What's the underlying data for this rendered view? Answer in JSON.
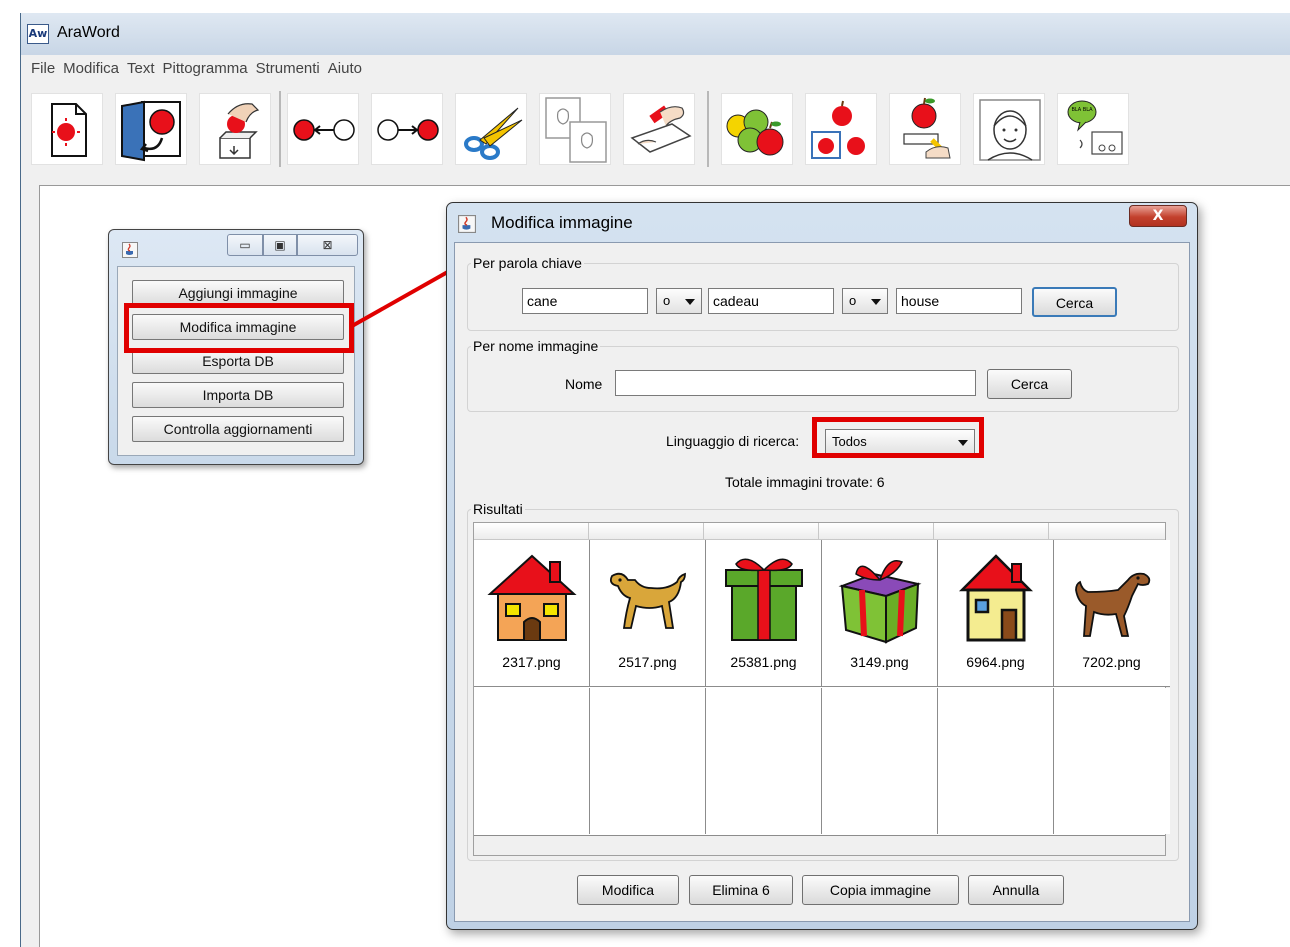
{
  "app": {
    "icon_text": "Aw",
    "title": "AraWord"
  },
  "menu": [
    "File",
    "Modifica",
    "Text",
    "Pittogramma",
    "Strumenti",
    "Aiuto"
  ],
  "db_dialog": {
    "buttons": [
      "Aggiungi immagine",
      "Modifica immagine",
      "Esporta DB",
      "Importa DB",
      "Controlla aggiornamenti"
    ]
  },
  "edit_dialog": {
    "title": "Modifica immagine",
    "close_label": "X",
    "keyword_section": {
      "label": "Per parola chiave",
      "field1": "cane",
      "op1": "o",
      "field2": "cadeau",
      "op2": "o",
      "field3": "house",
      "search_label": "Cerca"
    },
    "name_section": {
      "label": "Per nome immagine",
      "name_label": "Nome",
      "name_value": "",
      "search_label": "Cerca"
    },
    "language_label": "Linguaggio di ricerca:",
    "language_value": "Todos",
    "total_label": "Totale immagini trovate:  6",
    "results_label": "Risultati",
    "results": [
      {
        "file": "2317.png",
        "icon": "house-orange-icon"
      },
      {
        "file": "2517.png",
        "icon": "dog-yellow-icon"
      },
      {
        "file": "25381.png",
        "icon": "gift-green-icon"
      },
      {
        "file": "3149.png",
        "icon": "gift-purple-icon"
      },
      {
        "file": "6964.png",
        "icon": "house-yellow-icon"
      },
      {
        "file": "7202.png",
        "icon": "dog-brown-icon"
      }
    ],
    "buttons": {
      "modify": "Modifica",
      "delete": "Elimina 6",
      "copy": "Copia immagine",
      "cancel": "Annulla"
    }
  },
  "colors": {
    "highlight": "#e00000",
    "titlebar": "#c8d6e6"
  }
}
